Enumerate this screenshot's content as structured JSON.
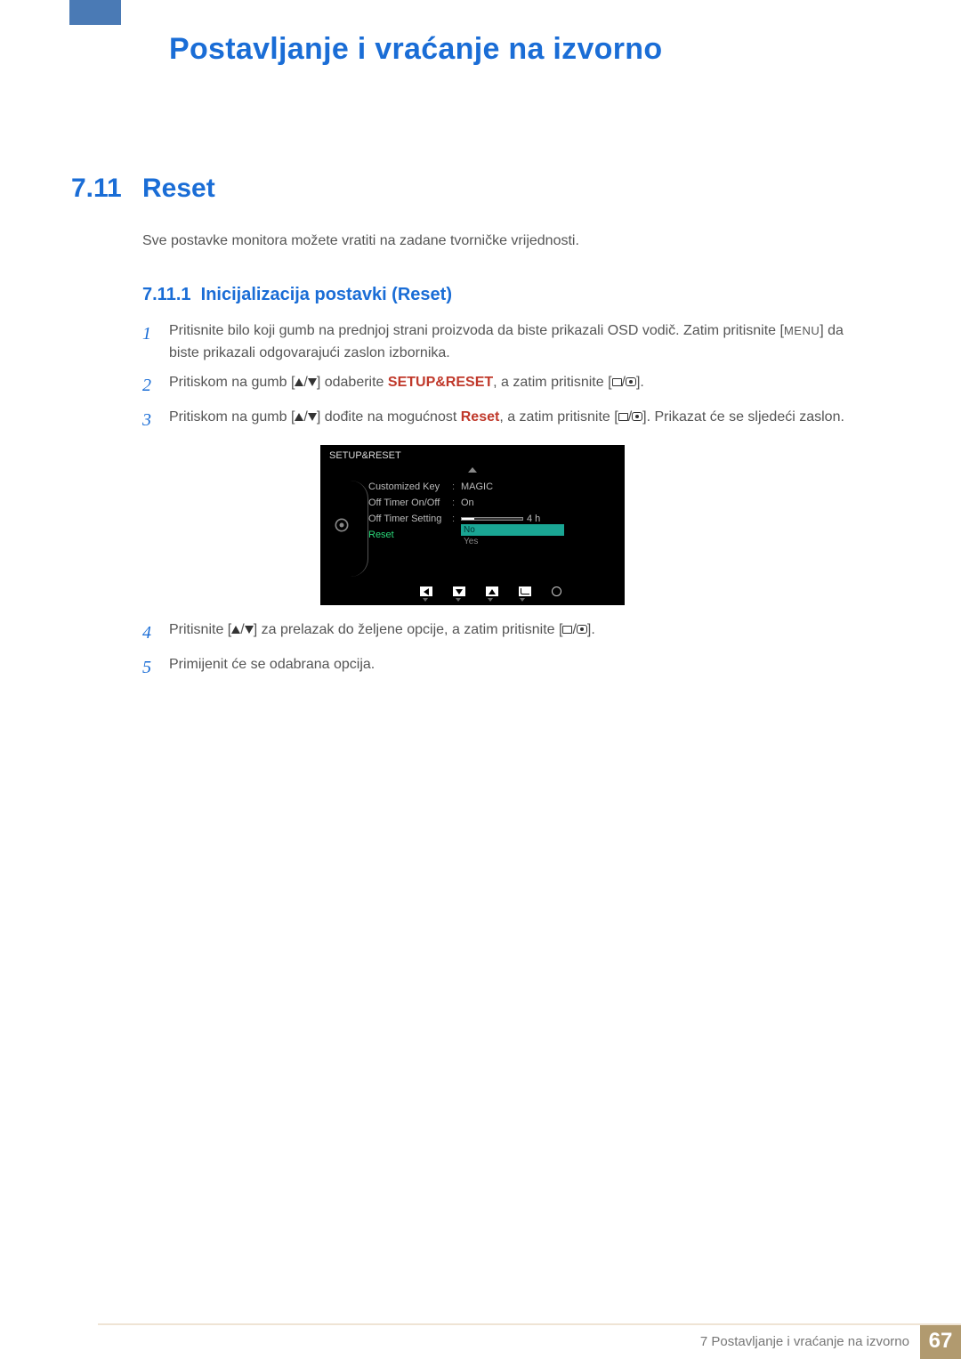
{
  "chapter_title": "Postavljanje i vraćanje na izvorno",
  "section": {
    "num": "7.11",
    "title": "Reset"
  },
  "intro": "Sve postavke monitora možete vratiti na zadane tvorničke vrijednosti.",
  "subsection": {
    "num": "7.11.1",
    "title": "Inicijalizacija postavki (Reset)"
  },
  "steps": {
    "s1a": "Pritisnite bilo koji gumb na prednjoj strani proizvoda da biste prikazali OSD vodič. Zatim pritisnite [",
    "s1_menu": "MENU",
    "s1b": "] da biste prikazali odgovarajući zaslon izbornika.",
    "s2a": "Pritiskom na gumb [",
    "s2b": "] odaberite ",
    "s2_hl": "SETUP&RESET",
    "s2c": ", a zatim pritisnite [",
    "s2d": "].",
    "s3a": "Pritiskom na gumb [",
    "s3b": "] dođite na mogućnost ",
    "s3_hl": "Reset",
    "s3c": ", a zatim pritisnite [",
    "s3d": "]. Prikazat će se sljedeći zaslon.",
    "s4a": "Pritisnite [",
    "s4b": "] za prelazak do željene opcije, a zatim pritisnite [",
    "s4c": "].",
    "s5": "Primijenit će se odabrana opcija."
  },
  "osd": {
    "title": "SETUP&RESET",
    "items": [
      {
        "label": "Customized Key",
        "value": "MAGIC"
      },
      {
        "label": "Off Timer On/Off",
        "value": "On"
      },
      {
        "label": "Off Timer Setting",
        "value_suffix": "4 h"
      },
      {
        "label": "Reset",
        "selected_option": "No",
        "other_option": "Yes"
      }
    ]
  },
  "footer": {
    "text": "7 Postavljanje i vraćanje na izvorno",
    "page": "67"
  }
}
